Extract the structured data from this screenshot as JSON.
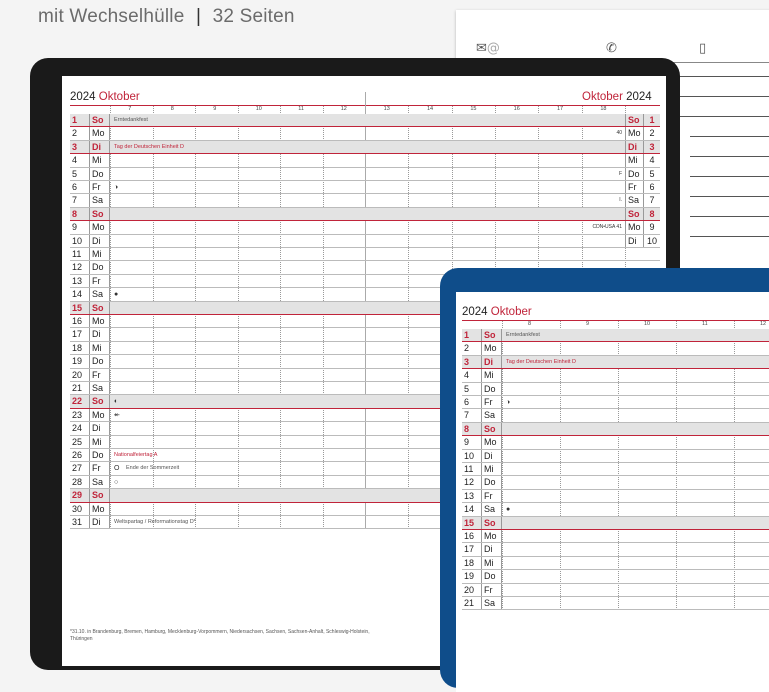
{
  "header": {
    "subtitle": "mit Wechselhülle",
    "separator": "|",
    "pages": "32 Seiten"
  },
  "contact_card": {
    "icons": [
      "mail-icon",
      "phone-icon",
      "mobile-icon"
    ],
    "mail_symbol": "@"
  },
  "calendar": {
    "year": "2024",
    "month": "Oktober",
    "left_hours": [
      "7",
      "8",
      "9",
      "10",
      "11",
      "12"
    ],
    "right_hours": [
      "13",
      "14",
      "15",
      "16",
      "17",
      "18"
    ],
    "days": [
      {
        "d": "1",
        "w": "So",
        "sun": true,
        "ev": "Erntedankfest"
      },
      {
        "d": "2",
        "w": "Mo",
        "r": "40"
      },
      {
        "d": "3",
        "w": "Di",
        "sun": true,
        "ev": "Tag der Deutschen Einheit D",
        "red": true
      },
      {
        "d": "4",
        "w": "Mi"
      },
      {
        "d": "5",
        "w": "Do",
        "r": "F"
      },
      {
        "d": "6",
        "w": "Fr",
        "sym": "◑"
      },
      {
        "d": "7",
        "w": "Sa",
        "r": "I."
      },
      {
        "d": "8",
        "w": "So",
        "sun": true
      },
      {
        "d": "9",
        "w": "Mo",
        "r": "CDN•USA 41"
      },
      {
        "d": "10",
        "w": "Di"
      },
      {
        "d": "11",
        "w": "Mi"
      },
      {
        "d": "12",
        "w": "Do"
      },
      {
        "d": "13",
        "w": "Fr"
      },
      {
        "d": "14",
        "w": "Sa",
        "sym": "●"
      },
      {
        "d": "15",
        "w": "So",
        "sun": true
      },
      {
        "d": "16",
        "w": "Mo"
      },
      {
        "d": "17",
        "w": "Di"
      },
      {
        "d": "18",
        "w": "Mi"
      },
      {
        "d": "19",
        "w": "Do"
      },
      {
        "d": "20",
        "w": "Fr"
      },
      {
        "d": "21",
        "w": "Sa"
      },
      {
        "d": "22",
        "w": "So",
        "sun": true,
        "sym": "◐"
      },
      {
        "d": "23",
        "w": "Mo",
        "sym": "↞"
      },
      {
        "d": "24",
        "w": "Di"
      },
      {
        "d": "25",
        "w": "Mi"
      },
      {
        "d": "26",
        "w": "Do",
        "ev": "Nationalfeiertag A",
        "red": true
      },
      {
        "d": "27",
        "w": "Fr",
        "sym": "O",
        "ev2": "Ende der Sommerzeit"
      },
      {
        "d": "28",
        "w": "Sa",
        "sym": "○"
      },
      {
        "d": "29",
        "w": "So",
        "sun": true
      },
      {
        "d": "30",
        "w": "Mo"
      },
      {
        "d": "31",
        "w": "Di",
        "ev": "Weltspartag / Reformationstag D*"
      }
    ],
    "footnote": "*31.10. in Brandenburg, Bremen, Hamburg, Mecklenburg-Vorpommern, Niedersachsen, Sachsen, Sachsen-Anhalt, Schleswig-Holstein, Thüringen",
    "second_hours": [
      "8",
      "9",
      "10",
      "11",
      "12"
    ],
    "second_days_count": 21
  },
  "colors": {
    "accent_red": "#c0243a",
    "tablet_dark": "#1a1a1a",
    "tablet_blue": "#0f4d8a"
  }
}
